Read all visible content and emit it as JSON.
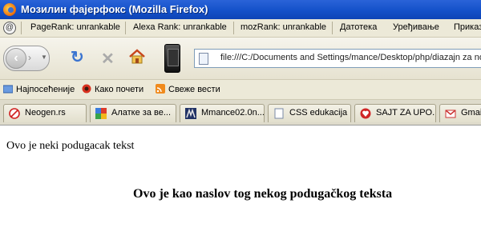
{
  "window": {
    "title": "Мозилин фајерфокс (Mozilla Firefox)"
  },
  "menubar": {
    "pagerank": "PageRank: unrankable",
    "alexa": "Alexa Rank: unrankable",
    "mozrank": "mozRank: unrankable",
    "menus": [
      "Датотека",
      "Уређивање",
      "Приказ"
    ]
  },
  "navbar": {
    "url": "file:///C:/Documents and Settings/mance/Desktop/php/diazajn za no"
  },
  "bookmarks": [
    "Најпосећеније",
    "Како почети",
    "Свеже вести"
  ],
  "tabs": [
    "Neogen.rs",
    "Алатке за ве...",
    "Mmance02.0n...",
    "CSS edukacija",
    "SAJT ZA UPO...",
    "Gmail"
  ],
  "page": {
    "paragraph": "Ovo je neki podugacak tekst",
    "heading": "Ovo je kao naslov tog nekog podugačkog teksta"
  },
  "colors": {
    "titlebar": "#1451c9",
    "chrome": "#ece9d8",
    "accent": "#3b74d0"
  }
}
